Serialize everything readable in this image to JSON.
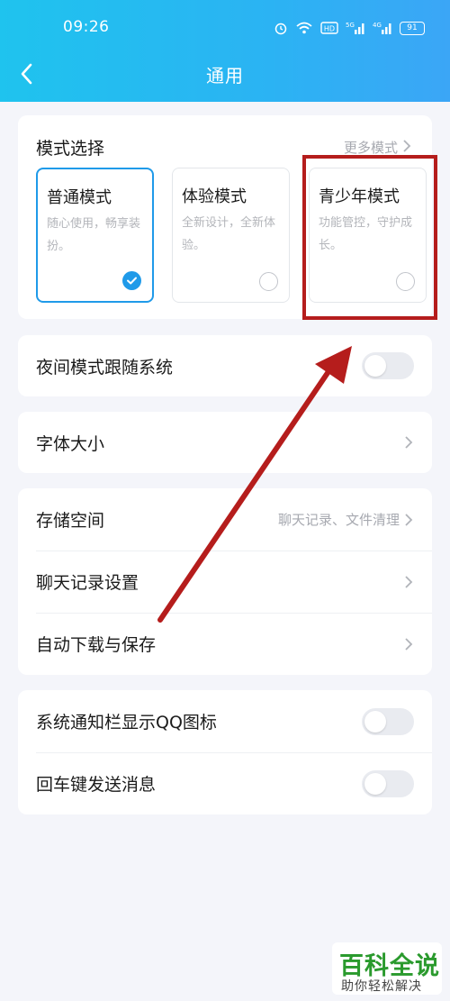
{
  "status_bar": {
    "time": "09:26",
    "battery": "91"
  },
  "header": {
    "title": "通用"
  },
  "mode_section": {
    "title": "模式选择",
    "more_label": "更多模式",
    "modes": [
      {
        "name": "普通模式",
        "desc": "随心使用，畅享装扮。",
        "selected": true
      },
      {
        "name": "体验模式",
        "desc": "全新设计，全新体验。",
        "selected": false
      },
      {
        "name": "青少年模式",
        "desc": "功能管控，守护成长。",
        "selected": false
      }
    ]
  },
  "night_mode": {
    "label": "夜间模式跟随系统",
    "on": false
  },
  "font_size": {
    "label": "字体大小"
  },
  "storage_group": {
    "storage": {
      "label": "存储空间",
      "value": "聊天记录、文件清理"
    },
    "chat_settings": {
      "label": "聊天记录设置"
    },
    "auto_download": {
      "label": "自动下载与保存"
    }
  },
  "toggles_group": {
    "notification_icon": {
      "label": "系统通知栏显示QQ图标",
      "on": false
    },
    "enter_send": {
      "label": "回车键发送消息",
      "on": false
    }
  },
  "watermark": {
    "main": "百科全说",
    "sub": "助你轻松解决"
  },
  "colors": {
    "header_start": "#1fc3ee",
    "header_end": "#3ba6f6",
    "accent": "#1f9ae9",
    "annotation": "#b51d1c"
  }
}
